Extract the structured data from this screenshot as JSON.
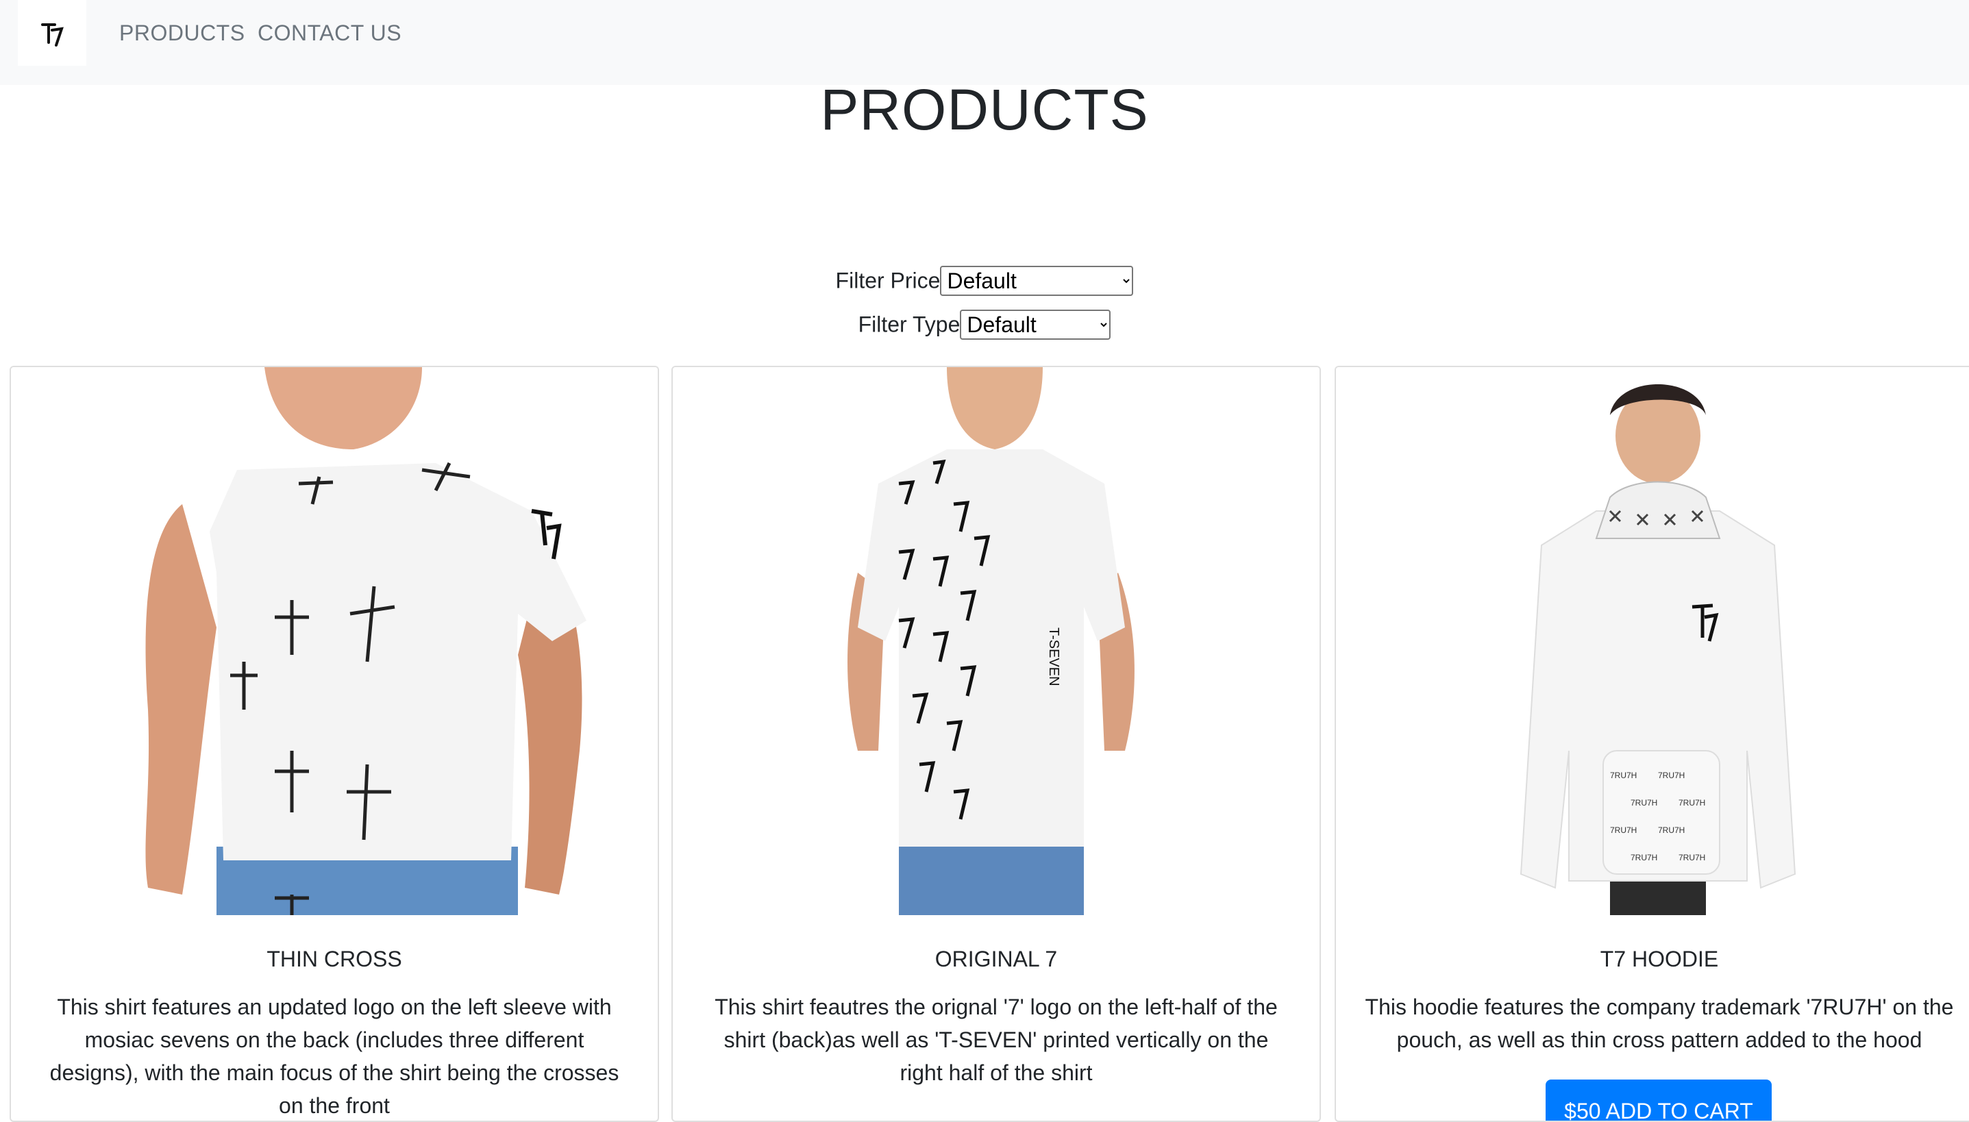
{
  "nav": {
    "brand_logo": "T7 logo mark",
    "links": [
      "PRODUCTS",
      "CONTACT US"
    ]
  },
  "page": {
    "title": "PRODUCTS"
  },
  "filters": {
    "price": {
      "label": "Filter Price",
      "selected": "Default"
    },
    "type": {
      "label": "Filter Type",
      "selected": "Default"
    }
  },
  "products": [
    {
      "name": "THIN CROSS",
      "image": "white t-shirt with black cross pattern, front view",
      "description": "This shirt features an updated logo on the left sleeve with mosiac sevens on the back (includes three different designs), with the main focus of the shirt being the crosses on the front"
    },
    {
      "name": "ORIGINAL 7",
      "image": "white t-shirt with '7' pattern, back view",
      "description": "This shirt feautres the orignal '7' logo on the left-half of the shirt (back)as well as 'T-SEVEN' printed vertically on the right half of the shirt"
    },
    {
      "name": "T7 HOODIE",
      "image": "white hoodie with T7 logo and patterned pouch",
      "description": "This hoodie features the company trademark '7RU7H' on the pouch, as well as thin cross pattern added to the hood",
      "button": "$50 ADD TO CART"
    }
  ],
  "colors": {
    "navbar_bg": "#f8f9fa",
    "nav_link": "#6c757d",
    "primary_button": "#007bff",
    "text": "#212529"
  }
}
